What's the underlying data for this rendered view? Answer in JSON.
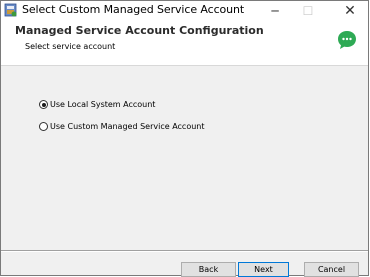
{
  "window": {
    "title": "Select Custom Managed Service Account",
    "minimize_glyph": "─",
    "maximize_glyph": "☐",
    "close_glyph": "✕"
  },
  "banner": {
    "title": "Managed Service Account Configuration",
    "subtitle": "Select service account",
    "icon": "chat-bubble-icon"
  },
  "options": [
    {
      "label": "Use Local System Account",
      "selected": true
    },
    {
      "label": "Use Custom Managed Service Account",
      "selected": false
    }
  ],
  "buttons": {
    "back": "Back",
    "next": "Next",
    "cancel": "Cancel"
  },
  "colors": {
    "accent": "#0078d7",
    "chat_icon": "#2eaa55"
  }
}
